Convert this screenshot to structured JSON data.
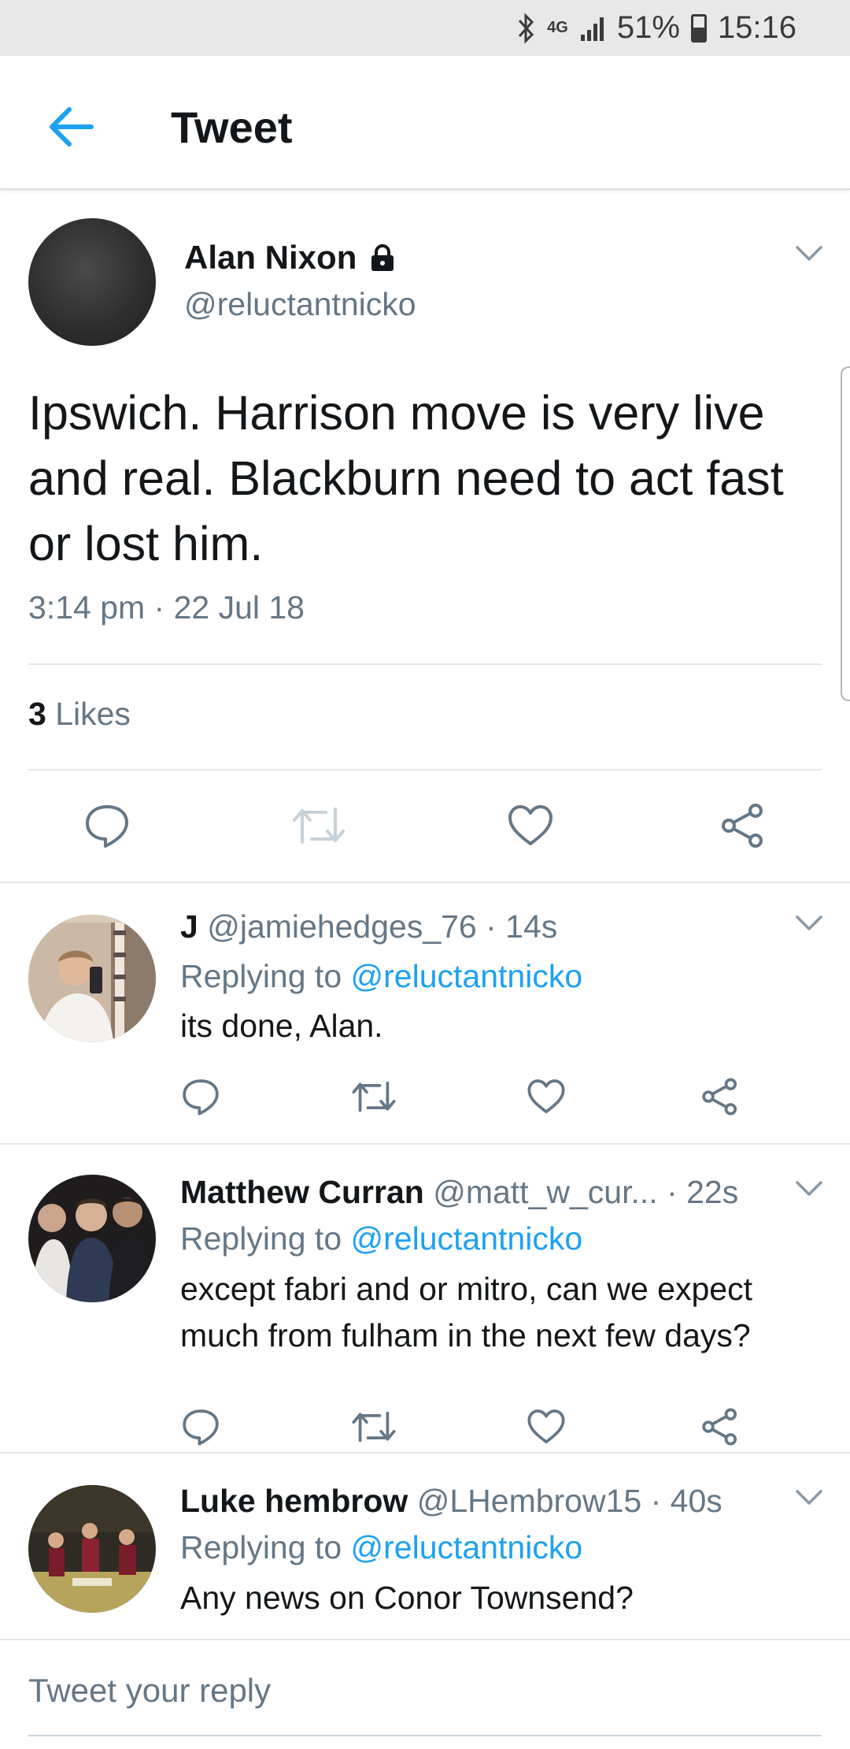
{
  "status_bar": {
    "network": "4G",
    "battery": "51%",
    "battery_level": 0.51,
    "time": "15:16"
  },
  "app_bar": {
    "title": "Tweet"
  },
  "tweet": {
    "author_name": "Alan Nixon",
    "author_handle": "@reluctantnicko",
    "text": "Ipswich. Harrison move is very live and real. Blackburn need to act fast or lost him.",
    "timestamp": "3:14 pm · 22 Jul 18",
    "likes_count": "3",
    "likes_label": "Likes"
  },
  "replies": [
    {
      "name": "J",
      "handle": "@jamiehedges_76",
      "age": "· 14s",
      "replying_prefix": "Replying to",
      "replying_to": "@reluctantnicko",
      "text": "its done, Alan."
    },
    {
      "name": "Matthew Curran",
      "handle": "@matt_w_cur...",
      "age": "· 22s",
      "replying_prefix": "Replying to",
      "replying_to": "@reluctantnicko",
      "text": "except fabri and or mitro, can we expect much from fulham in the next few days?"
    },
    {
      "name": "Luke hembrow",
      "handle": "@LHembrow15",
      "age": "· 40s",
      "replying_prefix": "Replying to",
      "replying_to": "@reluctantnicko",
      "text": "Any news on Conor Townsend?"
    }
  ],
  "composer": {
    "placeholder": "Tweet your reply"
  },
  "colors": {
    "accent": "#1da1f2",
    "secondary_text": "#657786",
    "primary_text": "#14171a"
  },
  "icons": [
    "bluetooth-icon",
    "signal-icon",
    "battery-icon",
    "back-arrow-icon",
    "lock-icon",
    "chevron-down-icon",
    "reply-icon",
    "retweet-icon",
    "like-icon",
    "share-icon"
  ]
}
